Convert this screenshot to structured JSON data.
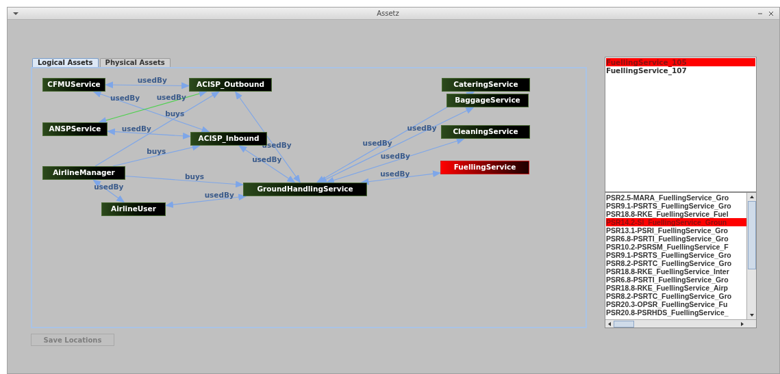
{
  "window": {
    "title": "Assetz"
  },
  "tabs": [
    {
      "label": "Logical Assets",
      "selected": true
    },
    {
      "label": "Physical Assets",
      "selected": false
    }
  ],
  "graph": {
    "nodes": [
      {
        "label": "CFMUService",
        "selected": false
      },
      {
        "label": "ACISP_Outbound",
        "selected": false
      },
      {
        "label": "ANSPService",
        "selected": false
      },
      {
        "label": "ACISP_Inbound",
        "selected": false
      },
      {
        "label": "AirlineManager",
        "selected": false
      },
      {
        "label": "AirlineUser",
        "selected": false
      },
      {
        "label": "GroundHandlingService",
        "selected": false
      },
      {
        "label": "CateringService",
        "selected": false
      },
      {
        "label": "BaggageService",
        "selected": false
      },
      {
        "label": "CleaningService",
        "selected": false
      },
      {
        "label": "FuellingService",
        "selected": true
      }
    ],
    "edges": [
      {
        "label": "usedBy",
        "kind": "both",
        "selected": false
      },
      {
        "label": "usedBy",
        "kind": "both",
        "selected": false
      },
      {
        "label": "usedBy",
        "kind": "both",
        "selected": true
      },
      {
        "label": "usedBy",
        "kind": "both",
        "selected": false
      },
      {
        "label": "buys",
        "kind": "end",
        "selected": false
      },
      {
        "label": "buys",
        "kind": "end",
        "selected": false
      },
      {
        "label": "buys",
        "kind": "end",
        "selected": false
      },
      {
        "label": "usedBy",
        "kind": "both",
        "selected": false
      },
      {
        "label": "usedBy",
        "kind": "both",
        "selected": false
      },
      {
        "label": "usedBy",
        "kind": "both",
        "selected": false
      },
      {
        "label": "usedBy",
        "kind": "both",
        "selected": false
      },
      {
        "label": "usedBy",
        "kind": "both",
        "selected": false
      },
      {
        "label": "usedBy",
        "kind": "both",
        "selected": false
      },
      {
        "label": "usedBy",
        "kind": "both",
        "selected": false
      },
      {
        "label": "usedBy",
        "kind": "both",
        "selected": false
      }
    ]
  },
  "instances": [
    {
      "label": "FuellingService_105",
      "selected": true
    },
    {
      "label": "FuellingService_107",
      "selected": false
    }
  ],
  "requirements": [
    {
      "label": "PSR2.5-MARA_FuellingService_Gro",
      "selected": false
    },
    {
      "label": "PSR9.1-PSRTS_FuellingService_Gro",
      "selected": false
    },
    {
      "label": "PSR18.8-RKE_FuellingService_Fuel",
      "selected": false
    },
    {
      "label": "PSR14.2-SI_FuellingService_Groun",
      "selected": true
    },
    {
      "label": "PSR13.1-PSRI_FuellingService_Gro",
      "selected": false
    },
    {
      "label": "PSR6.8-PSRTI_FuellingService_Gro",
      "selected": false
    },
    {
      "label": "PSR10.2-PSRSM_FuellingService_F",
      "selected": false
    },
    {
      "label": "PSR9.1-PSRTS_FuellingService_Gro",
      "selected": false
    },
    {
      "label": "PSR8.2-PSRTC_FuellingService_Gro",
      "selected": false
    },
    {
      "label": "PSR18.8-RKE_FuellingService_Inter",
      "selected": false
    },
    {
      "label": "PSR6.8-PSRTI_FuellingService_Gro",
      "selected": false
    },
    {
      "label": "PSR18.8-RKE_FuellingService_Airp",
      "selected": false
    },
    {
      "label": "PSR8.2-PSRTC_FuellingService_Gro",
      "selected": false
    },
    {
      "label": "PSR20.3-OPSR_FuellingService_Fu",
      "selected": false
    },
    {
      "label": "PSR20.8-PSRHDS_FuellingService_",
      "selected": false
    }
  ],
  "save_button": {
    "label": "Save Locations",
    "disabled": true
  }
}
